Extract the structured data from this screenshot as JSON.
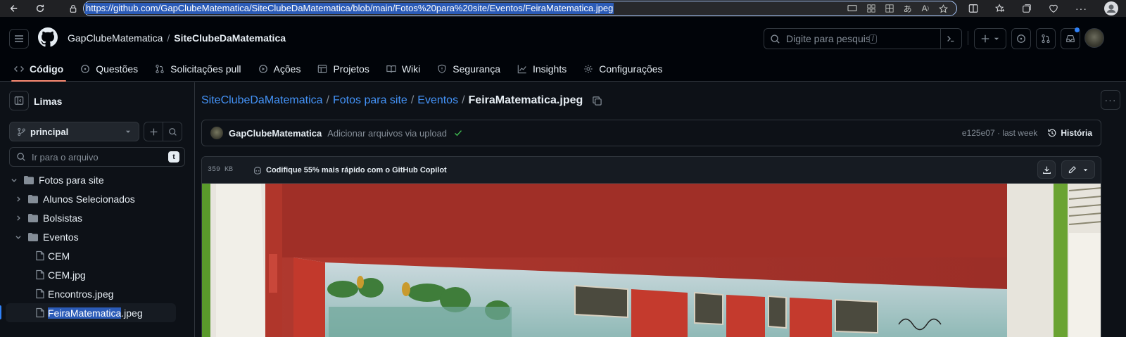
{
  "browser": {
    "url": "https://github.com/GapClubeMatematica/SiteClubeDaMatematica/blob/main/Fotos%20para%20site/Eventos/FeiraMatematica.jpeg"
  },
  "header": {
    "owner": "GapClubeMatematica",
    "separator": "/",
    "repo": "SiteClubeDaMatematica",
    "search_placeholder": "Digite para pesquisar",
    "search_kbd": "/"
  },
  "tabs": [
    {
      "label": "Código",
      "icon": "code-icon",
      "active": true
    },
    {
      "label": "Questões",
      "icon": "issue-icon"
    },
    {
      "label": "Solicitações pull",
      "icon": "pull-request-icon"
    },
    {
      "label": "Ações",
      "icon": "play-icon"
    },
    {
      "label": "Projetos",
      "icon": "table-icon"
    },
    {
      "label": "Wiki",
      "icon": "book-icon"
    },
    {
      "label": "Segurança",
      "icon": "shield-icon"
    },
    {
      "label": "Insights",
      "icon": "graph-icon"
    },
    {
      "label": "Configurações",
      "icon": "gear-icon"
    }
  ],
  "sidebar": {
    "title": "Limas",
    "branch": "principal",
    "goto_placeholder": "Ir para o arquivo",
    "goto_kbd": "t",
    "tree": [
      {
        "label": "Fotos para site",
        "type": "folder",
        "expanded": true
      },
      {
        "label": "Alunos Selecionados",
        "type": "folder"
      },
      {
        "label": "Bolsistas",
        "type": "folder"
      },
      {
        "label": "Eventos",
        "type": "folder",
        "expanded": true
      },
      {
        "label": "CEM",
        "type": "file"
      },
      {
        "label": "CEM.jpg",
        "type": "file"
      },
      {
        "label": "Encontros.jpeg",
        "type": "file"
      },
      {
        "label_hl": "FeiraMatematica",
        "label_rest": ".jpeg",
        "type": "file",
        "selected": true
      }
    ]
  },
  "main": {
    "path": [
      "SiteClubeDaMatematica",
      "Fotos para site",
      "Eventos"
    ],
    "path_sep": "/",
    "current_file": "FeiraMatematica.jpeg",
    "commit": {
      "author": "GapClubeMatematica",
      "message": "Adicionar arquivos via upload",
      "hash_time": "e125e07 · last week",
      "history_label": "História"
    },
    "file": {
      "size": "359 KB",
      "copilot_text": "Codifique 55% mais rápido com o GitHub Copilot"
    }
  },
  "colors": {
    "accent": "#4493f8",
    "tab_underline": "#fd8c73",
    "success": "#3fb950"
  }
}
